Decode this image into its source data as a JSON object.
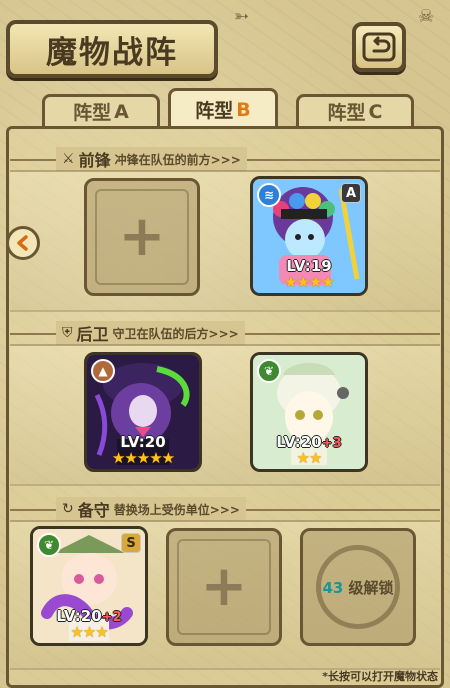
{
  "header": {
    "title": "魔物战阵",
    "back_icon": "return-icon"
  },
  "tabs": [
    {
      "label": "阵型",
      "letter": "A",
      "active": false
    },
    {
      "label": "阵型",
      "letter": "B",
      "active": true
    },
    {
      "label": "阵型",
      "letter": "C",
      "active": false
    }
  ],
  "sections": {
    "front": {
      "name": "前锋",
      "desc": "冲锋在队伍的前方>>>"
    },
    "back": {
      "name": "后卫",
      "desc": "守卫在队伍的后方>>>"
    },
    "reserve": {
      "name": "备守",
      "desc": "替换场上受伤单位>>>"
    }
  },
  "front_slots": [
    {
      "type": "empty"
    },
    {
      "type": "card",
      "rank": "A",
      "level": "LV:19",
      "bonus": "",
      "stars": "★★★★",
      "element_color": "#2f7ed8",
      "frame": "blue"
    }
  ],
  "back_slots": [
    {
      "type": "card",
      "rank": "",
      "level": "LV:20",
      "bonus": "",
      "stars": "★★★★★",
      "element_color": "#b06a3a",
      "frame": "purple"
    },
    {
      "type": "card",
      "rank": "",
      "level": "LV:20",
      "bonus": "+3",
      "stars": "★★",
      "element_color": "#3f8a2f",
      "frame": "green"
    }
  ],
  "reserve_slots": [
    {
      "type": "card",
      "rank": "S",
      "level": "LV:20",
      "bonus": "+2",
      "stars": "★★★",
      "element_color": "#3f8a2f",
      "frame": "gold"
    },
    {
      "type": "empty"
    },
    {
      "type": "locked",
      "unlock_level": "43",
      "unlock_text": "级解锁"
    }
  ],
  "hint": "*长按可以打开魔物状态",
  "colors": {
    "background": "#d6c590",
    "border": "#6b5634",
    "accent_letter": "#e07a12",
    "star": "#ffc21c",
    "unlock_number": "#16989a"
  }
}
